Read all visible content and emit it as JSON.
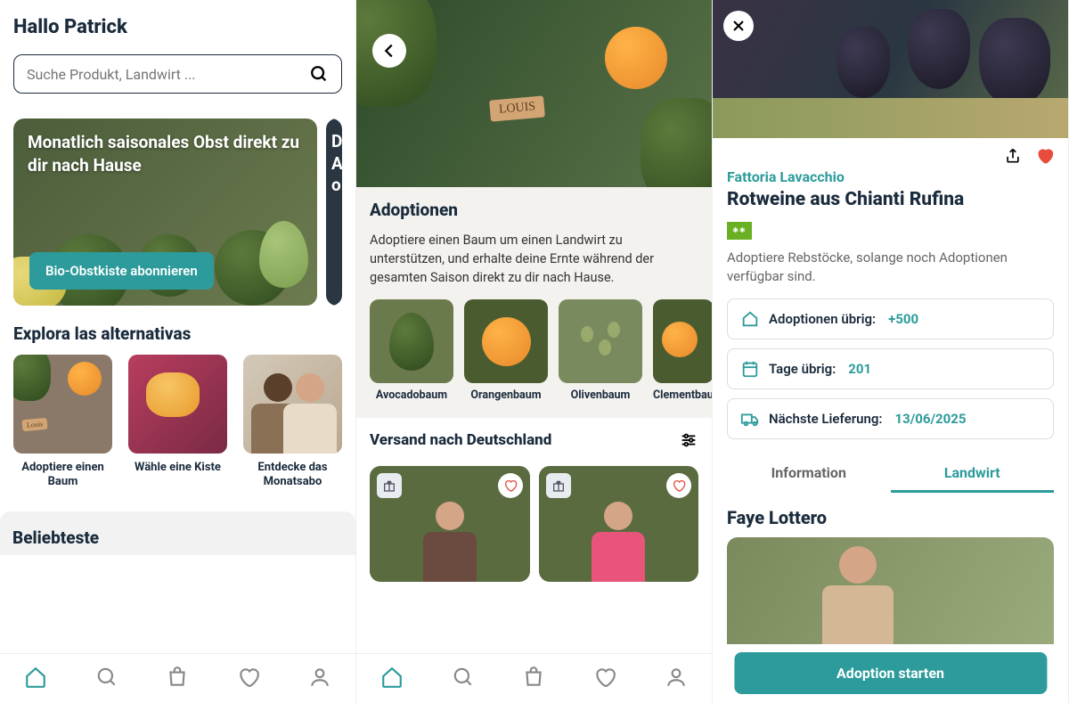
{
  "screen1": {
    "greeting": "Hallo Patrick",
    "search_placeholder": "Suche Produkt, Landwirt ...",
    "hero_text": "Monatlich saisonales Obst direkt zu dir nach Hause",
    "hero_btn": "Bio-Obstkiste abonnieren",
    "hero_peek_text": "D\nA\no",
    "explore_title": "Explora las alternativas",
    "alts": [
      {
        "label": "Adoptiere einen Baum"
      },
      {
        "label": "Wähle eine Kiste"
      },
      {
        "label": "Entdecke das Monatsabo"
      }
    ],
    "popular_title": "Beliebteste"
  },
  "screen2": {
    "title": "Adoptionen",
    "desc": "Adoptiere einen Baum um einen Landwirt zu unterstützen, und erhalte deine Ernte während der gesamten Saison direkt zu dir nach Hause.",
    "adoptions": [
      {
        "label": "Avocadobaum"
      },
      {
        "label": "Orangenbaum"
      },
      {
        "label": "Olivenbaum"
      },
      {
        "label": "Clement­bau"
      }
    ],
    "shipping_title": "Versand nach Deutschland",
    "sign": "LOUIS"
  },
  "screen3": {
    "vendor": "Fattoria Lavacchio",
    "title": "Rotweine aus Chianti Rufina",
    "desc": "Adoptiere Rebstöcke, solange noch Adoptionen verfügbar sind.",
    "stats": [
      {
        "label": "Adoptionen übrig:",
        "value": "+500"
      },
      {
        "label": "Tage übrig:",
        "value": "201"
      },
      {
        "label": "Nächste Lieferung:",
        "value": "13/06/2025"
      }
    ],
    "tabs": {
      "info": "Information",
      "farmer": "Landwirt"
    },
    "farmer_name": "Faye Lottero",
    "cta": "Adoption starten"
  }
}
